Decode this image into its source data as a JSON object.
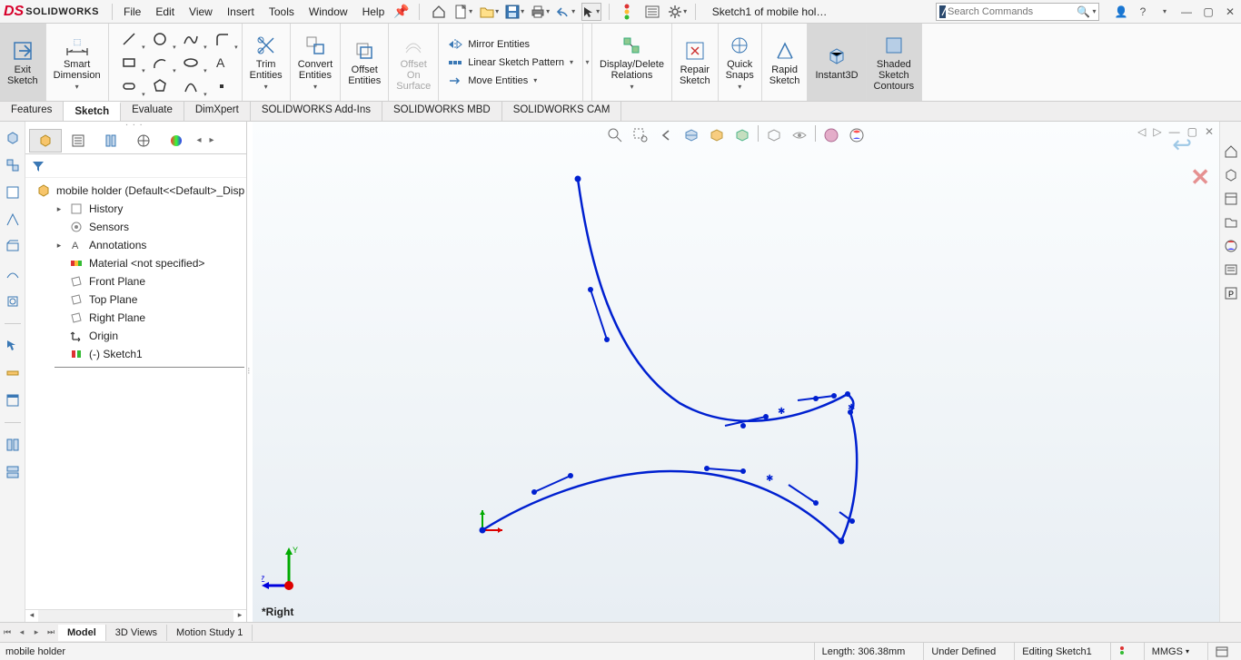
{
  "app": {
    "logo_text": "SOLIDWORKS",
    "document_display": "Sketch1 of mobile hol…",
    "search_placeholder": "Search Commands"
  },
  "menu": {
    "file": "File",
    "edit": "Edit",
    "view": "View",
    "insert": "Insert",
    "tools": "Tools",
    "window": "Window",
    "help": "Help"
  },
  "ribbon": {
    "exit_sketch": "Exit\nSketch",
    "smart_dimension": "Smart\nDimension",
    "trim_entities": "Trim\nEntities",
    "convert_entities": "Convert\nEntities",
    "offset_entities": "Offset\nEntities",
    "offset_on_surface": "Offset\nOn\nSurface",
    "mirror_entities": "Mirror Entities",
    "linear_pattern": "Linear Sketch Pattern",
    "move_entities": "Move Entities",
    "display_delete": "Display/Delete\nRelations",
    "repair_sketch": "Repair\nSketch",
    "quick_snaps": "Quick\nSnaps",
    "rapid_sketch": "Rapid\nSketch",
    "instant3d": "Instant3D",
    "shaded_contours": "Shaded\nSketch\nContours"
  },
  "cm_tabs": {
    "features": "Features",
    "sketch": "Sketch",
    "evaluate": "Evaluate",
    "dimxpert": "DimXpert",
    "addins": "SOLIDWORKS Add-Ins",
    "mbd": "SOLIDWORKS MBD",
    "cam": "SOLIDWORKS CAM"
  },
  "tree": {
    "root": "mobile holder  (Default<<Default>_Disp",
    "history": "History",
    "sensors": "Sensors",
    "annotations": "Annotations",
    "material": "Material <not specified>",
    "front": "Front Plane",
    "top": "Top Plane",
    "right": "Right Plane",
    "origin": "Origin",
    "sketch1": "(-) Sketch1"
  },
  "viewport": {
    "plane_label": "*Right"
  },
  "doc_tabs": {
    "model": "Model",
    "views3d": "3D Views",
    "motion": "Motion Study 1"
  },
  "status": {
    "doc": "mobile holder",
    "length": "Length: 306.38mm",
    "defined": "Under Defined",
    "editing": "Editing Sketch1",
    "units": "MMGS"
  },
  "icons": {
    "home": "⌂",
    "new": "🗋",
    "open": "📂",
    "save": "💾",
    "print": "🖨",
    "undo": "↶",
    "select": "↖",
    "rebuild": "⟳",
    "options": "⚙"
  }
}
